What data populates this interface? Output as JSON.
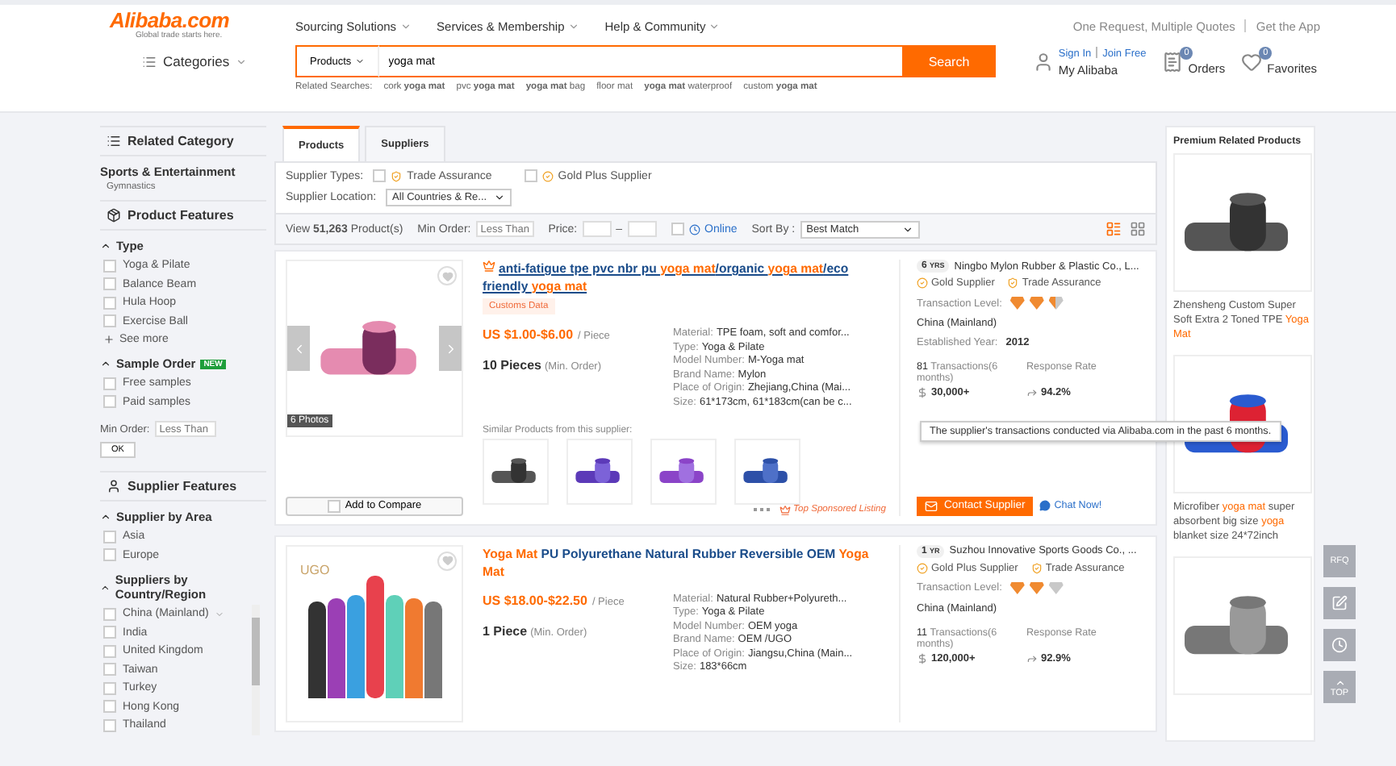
{
  "header": {
    "logo": "Alibaba.com",
    "tagline": "Global trade starts here.",
    "nav": [
      {
        "label": "Sourcing Solutions"
      },
      {
        "label": "Services & Membership"
      },
      {
        "label": "Help & Community"
      }
    ],
    "top_links": [
      "One Request, Multiple Quotes",
      "Get the App"
    ],
    "categories": "Categories",
    "search": {
      "scope": "Products",
      "value": "yoga mat",
      "button": "Search"
    },
    "related_label": "Related Searches:",
    "related": [
      "cork **yoga mat**",
      "pvc **yoga mat**",
      "**yoga mat** bag",
      "floor mat",
      "**yoga mat** waterproof",
      "custom **yoga mat**"
    ],
    "account": {
      "sign_in": "Sign In",
      "join": "Join Free",
      "label": "My Alibaba"
    },
    "orders": {
      "count": "0",
      "label": "Orders"
    },
    "favorites": {
      "count": "0",
      "label": "Favorites"
    }
  },
  "sidebar": {
    "related_title": "Related Category",
    "category": "Sports & Entertainment",
    "subcategory": "Gymnastics",
    "sections": [
      {
        "title": "Product Features",
        "groups": [
          {
            "title": "Type",
            "expanded": true,
            "options": [
              {
                "label": "Yoga & Pilate",
                "checked": false
              },
              {
                "label": "Balance Beam",
                "checked": false
              },
              {
                "label": "Hula Hoop",
                "checked": false
              },
              {
                "label": "Exercise Ball",
                "checked": false
              }
            ],
            "more": "See more"
          },
          {
            "title": "Sample Order",
            "badge": "NEW",
            "expanded": true,
            "options": [
              {
                "label": "Free samples",
                "checked": false
              },
              {
                "label": "Paid samples",
                "checked": false
              }
            ]
          }
        ],
        "min_order": {
          "label": "Min Order:",
          "placeholder": "Less Than",
          "button": "OK"
        }
      },
      {
        "title": "Supplier Features",
        "groups": [
          {
            "title": "Supplier by Area",
            "expanded": true,
            "options": [
              {
                "label": "Asia",
                "checked": false
              },
              {
                "label": "Europe",
                "checked": false
              }
            ]
          },
          {
            "title": "Suppliers by Country/Region",
            "expanded": true,
            "scroll": true,
            "options": [
              {
                "label": "China (Mainland)",
                "checked": false,
                "dropdown": true
              },
              {
                "label": "India",
                "checked": false
              },
              {
                "label": "United Kingdom",
                "checked": false
              },
              {
                "label": "Taiwan",
                "checked": false
              },
              {
                "label": "Turkey",
                "checked": false
              },
              {
                "label": "Hong Kong",
                "checked": false
              },
              {
                "label": "Thailand",
                "checked": false
              }
            ]
          }
        ]
      }
    ]
  },
  "tabs": [
    {
      "label": "Products",
      "selected": true
    },
    {
      "label": "Suppliers",
      "selected": false
    }
  ],
  "filters": {
    "types_label": "Supplier Types:",
    "types": [
      {
        "label": "Trade Assurance",
        "checked": false
      },
      {
        "label": "Gold Plus Supplier",
        "checked": false
      }
    ],
    "location_label": "Supplier Location:",
    "location": "All Countries & Re..."
  },
  "toolbar": {
    "count_text": "View **51,263** Product(s)",
    "min_order_label": "Min Order:",
    "min_order_placeholder": "Less Than",
    "price_label": "Price:",
    "price_sep": "–",
    "online": {
      "label": "Online",
      "checked": false
    },
    "sort_label": "Sort By :",
    "sort_value": "Best Match",
    "views": [
      {
        "selected": true
      },
      {
        "selected": false
      }
    ]
  },
  "products": [
    {
      "title": [
        {
          "text": "anti-fatigue tpe pvc nbr pu ",
          "highlight": false
        },
        {
          "text": "yoga mat",
          "highlight": true
        },
        {
          "text": "/organic ",
          "highlight": false
        },
        {
          "text": "yoga mat",
          "highlight": true
        },
        {
          "text": "/eco friendly ",
          "highlight": false
        },
        {
          "text": "yoga mat",
          "highlight": true
        }
      ],
      "crown": true,
      "badge": "Customs Data",
      "photos": "6 Photos",
      "favorite": false,
      "price": "US $1.00-$6.00",
      "unit": "/ Piece",
      "moq": "10 Pieces",
      "moq_note": "(Min. Order)",
      "attributes": [
        {
          "name": "Material:",
          "value": "TPE foam, soft and comfor..."
        },
        {
          "name": "Type:",
          "value": "Yoga & Pilate"
        },
        {
          "name": "Model Number:",
          "value": "M-Yoga mat"
        },
        {
          "name": "Brand Name:",
          "value": "Mylon"
        },
        {
          "name": "Place of Origin:",
          "value": "Zhejiang,China (Mai..."
        },
        {
          "name": "Size:",
          "value": "61*173cm, 61*183cm(can be c..."
        }
      ],
      "similar_label": "Similar Products from this supplier:",
      "compare": {
        "label": "Add to Compare",
        "checked": false
      },
      "sponsored": "Top Sponsored Listing",
      "supplier": {
        "years": "6",
        "years_unit": "YRS",
        "name": "Ningbo Mylon Rubber & Plastic Co., L...",
        "badges": [
          "Gold Supplier",
          "Trade Assurance"
        ],
        "level_label": "Transaction Level:",
        "stars": 2.5,
        "country": "China (Mainland)",
        "established_label": "Established Year:",
        "established": "2012",
        "transactions": "81",
        "transactions_label": "Transactions(6 months)",
        "volume": "30,000+",
        "response_label": "Response Rate",
        "response": "94.2%"
      },
      "tooltip": "The supplier's transactions conducted via Alibaba.com in the past 6 months.",
      "contact": "Contact Supplier",
      "chat": "Chat Now!"
    },
    {
      "title": [
        {
          "text": "Yoga Mat",
          "highlight": true
        },
        {
          "text": " PU Polyurethane Natural Rubber Reversible OEM ",
          "highlight": false
        },
        {
          "text": "Yoga Mat",
          "highlight": true
        }
      ],
      "crown": false,
      "favorite": false,
      "logo": "UGO",
      "price": "US $18.00-$22.50",
      "unit": "/ Piece",
      "moq": "1 Piece",
      "moq_note": "(Min. Order)",
      "attributes": [
        {
          "name": "Material:",
          "value": "Natural Rubber+Polyureth..."
        },
        {
          "name": "Type:",
          "value": "Yoga & Pilate"
        },
        {
          "name": "Model Number:",
          "value": "OEM yoga"
        },
        {
          "name": "Brand Name:",
          "value": "OEM /UGO"
        },
        {
          "name": "Place of Origin:",
          "value": "Jiangsu,China (Main..."
        },
        {
          "name": "Size:",
          "value": "183*66cm"
        }
      ],
      "supplier": {
        "years": "1",
        "years_unit": "YR",
        "name": "Suzhou Innovative Sports Goods Co., ...",
        "badges": [
          "Gold Plus Supplier",
          "Trade Assurance"
        ],
        "level_label": "Transaction Level:",
        "stars": 2,
        "country": "China (Mainland)",
        "transactions": "11",
        "transactions_label": "Transactions(6 months)",
        "volume": "120,000+",
        "response_label": "Response Rate",
        "response": "92.9%"
      }
    }
  ],
  "premium": {
    "title": "Premium Related Products",
    "items": [
      {
        "title": [
          {
            "text": "Zhensheng Custom Super Soft Extra 2 Toned TPE ",
            "highlight": false
          },
          {
            "text": "Yoga Mat",
            "highlight": true
          }
        ]
      },
      {
        "title": [
          {
            "text": "Microfiber ",
            "highlight": false
          },
          {
            "text": "yoga mat",
            "highlight": true
          },
          {
            "text": " super absorbent big size ",
            "highlight": false
          },
          {
            "text": "yoga",
            "highlight": true
          },
          {
            "text": " blanket size 24*72inch",
            "highlight": false
          }
        ]
      }
    ]
  },
  "side_tools": {
    "rfq": "RFQ",
    "top": "TOP"
  }
}
